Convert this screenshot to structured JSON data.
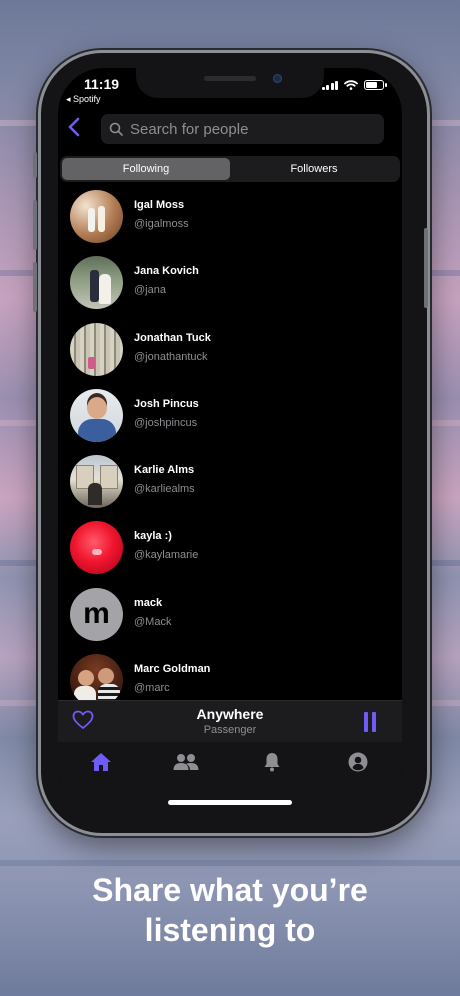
{
  "status_bar": {
    "time": "11:19",
    "back_app": "◂ Spotify"
  },
  "search": {
    "placeholder": "Search for people"
  },
  "segments": {
    "following": "Following",
    "followers": "Followers"
  },
  "people": [
    {
      "name": "Igal Moss",
      "handle": "@igalmoss",
      "avatar": "photo"
    },
    {
      "name": "Jana Kovich",
      "handle": "@jana",
      "avatar": "photo"
    },
    {
      "name": "Jonathan Tuck",
      "handle": "@jonathantuck",
      "avatar": "photo"
    },
    {
      "name": "Josh Pincus",
      "handle": "@joshpincus",
      "avatar": "photo"
    },
    {
      "name": "Karlie Alms",
      "handle": "@karliealms",
      "avatar": "photo"
    },
    {
      "name": "kayla :)",
      "handle": "@kaylamarie",
      "avatar": "photo"
    },
    {
      "name": "mack",
      "handle": "@Mack",
      "avatar_letter": "m"
    },
    {
      "name": "Marc Goldman",
      "handle": "@marc",
      "avatar": "photo"
    }
  ],
  "now_playing": {
    "track": "Anywhere",
    "artist": "Passenger"
  },
  "tabs": [
    "home-icon",
    "people-icon",
    "bell-icon",
    "profile-icon"
  ],
  "colors": {
    "accent": "#6f5cf5",
    "background": "#000000",
    "surface": "#1c1c1e",
    "secondary_text": "#8e8e93"
  },
  "caption": {
    "line1": "Share what you’re",
    "line2": "listening to"
  }
}
